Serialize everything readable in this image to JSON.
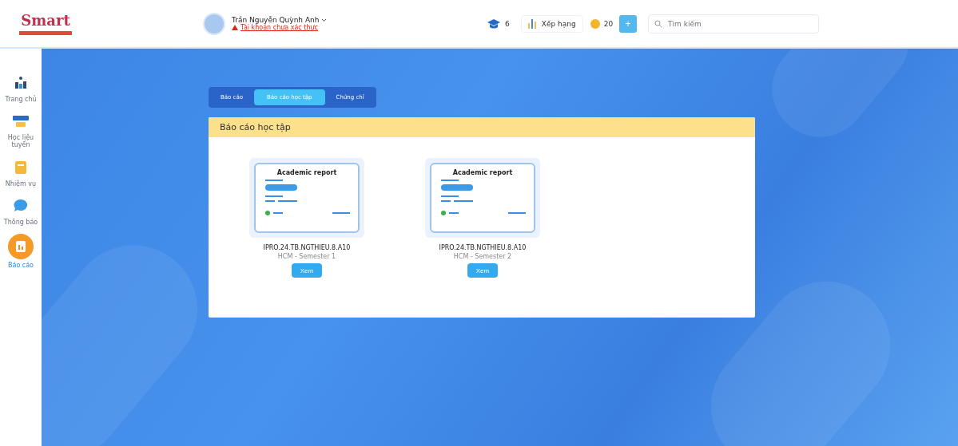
{
  "header": {
    "logo": "Smart",
    "user_name": "Trần Nguyễn Quỳnh Anh",
    "warning": "Tài khoản chưa xác thực",
    "caps": "6",
    "ranking": "Xếp hạng",
    "coins": "20",
    "add": "+",
    "search": {
      "placeholder": "Tìm kiếm"
    }
  },
  "sidebar": {
    "items": [
      {
        "label": "Trang chủ",
        "kind": "home",
        "selected": false
      },
      {
        "label": "Học liệu tuyển",
        "kind": "book",
        "selected": false
      },
      {
        "label": "Nhiệm vụ",
        "kind": "task",
        "selected": false
      },
      {
        "label": "Thông báo",
        "kind": "chat",
        "selected": false
      },
      {
        "label": "Báo cáo",
        "kind": "report",
        "selected": true
      }
    ]
  },
  "tabs": [
    {
      "label": "Báo cáo",
      "selected": false
    },
    {
      "label": "Báo cáo học tập",
      "selected": true
    },
    {
      "label": "Chứng chỉ",
      "selected": false
    }
  ],
  "panel": {
    "title": "Báo cáo học tập",
    "reports": [
      {
        "thumb_title": "Academic report",
        "code": "IPRO.24.TB.NGTHIEU.8.A10",
        "subtitle": "HCM - Semester 1",
        "button": "Xem"
      },
      {
        "thumb_title": "Academic report",
        "code": "IPRO.24.TB.NGTHIEU.8.A10",
        "subtitle": "HCM - Semester 2",
        "button": "Xem"
      }
    ]
  }
}
